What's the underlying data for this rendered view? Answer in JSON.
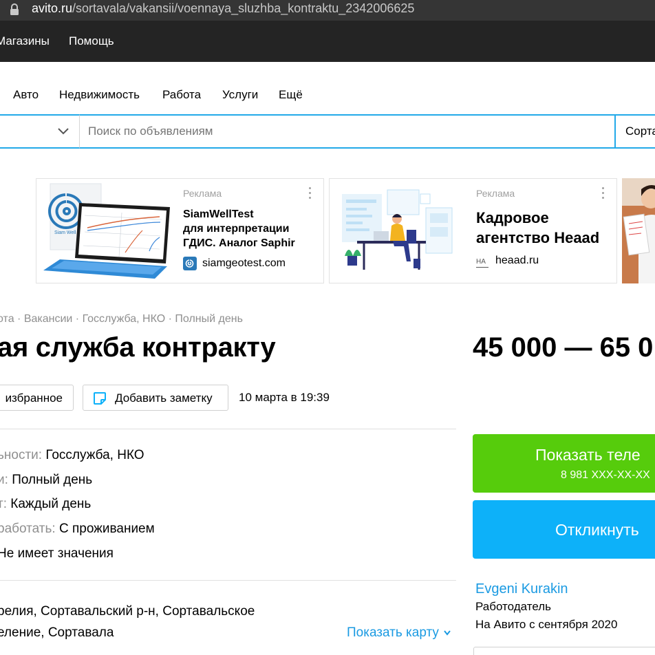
{
  "browser": {
    "url_domain": "avito.ru",
    "url_path": "/sortavala/vakansii/voennaya_sluzhba_kontraktu_2342006625"
  },
  "top_nav": {
    "shops": "Магазины",
    "help": "Помощь"
  },
  "categories": [
    "Авто",
    "Недвижимость",
    "Работа",
    "Услуги",
    "Ещё"
  ],
  "search": {
    "placeholder": "Поиск по объявлениям",
    "region": "Сорта"
  },
  "ads": [
    {
      "label": "Реклама",
      "title_lines": [
        "SiamWellTest",
        "для интерпретации",
        "ГДИС. Аналог Saphir"
      ],
      "domain": "siamgeotest.com",
      "image_caption": "Siam Well Test"
    },
    {
      "label": "Реклама",
      "title_lines": [
        "Кадровое",
        "агентство Heaad"
      ],
      "domain": "heaad.ru",
      "favicon_text": "HA"
    }
  ],
  "listing": {
    "breadcrumb": "ота · Вакансии · Госслужба, НКО · Полный день",
    "title": "ая служба контракту",
    "price": "45 000 — 65 0",
    "favorite_label": "избранное",
    "note_label": "Добавить заметку",
    "date": "10 марта в 19:39",
    "params": [
      {
        "key": "ьности:",
        "value": "Госслужба, НКО"
      },
      {
        "key": "и:",
        "value": "Полный день"
      },
      {
        "key": "т:",
        "value": "Каждый день"
      },
      {
        "key": "работать:",
        "value": "С проживанием"
      },
      {
        "key": "",
        "value": "Не имеет значения"
      }
    ],
    "address_lines": [
      "релия, Сортавальский р-н, Сортавальское",
      "еление, Сортавала"
    ],
    "show_map": "Показать карту"
  },
  "contact": {
    "phone_label": "Показать теле",
    "phone_number": "8 981 XXX-XX-XX",
    "reply_label": "Откликнуть"
  },
  "seller": {
    "name": "Evgeni Kurakin",
    "role": "Работодатель",
    "since": "На Авито с сентября 2020"
  },
  "colors": {
    "accent_blue": "#21a9e8",
    "link_blue": "#1a9ae2",
    "phone_green": "#56cc0c",
    "reply_blue": "#0db1f9",
    "nav_dark": "#242424"
  }
}
